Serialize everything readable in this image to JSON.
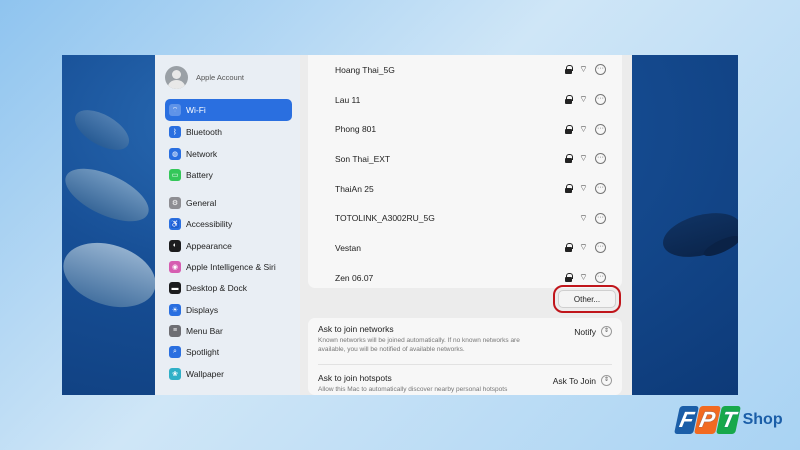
{
  "sidebar": {
    "account_label": "Apple Account",
    "items": [
      {
        "label": "Wi-Fi",
        "icon": "wifi-icon",
        "color": "#2a6fe0",
        "active": true
      },
      {
        "label": "Bluetooth",
        "icon": "bluetooth-icon",
        "color": "#2a6fe0"
      },
      {
        "label": "Network",
        "icon": "network-globe-icon",
        "color": "#2a6fe0"
      },
      {
        "label": "Battery",
        "icon": "battery-icon",
        "color": "#34c759"
      },
      {
        "label": "General",
        "icon": "gear-icon",
        "color": "#8e8e93"
      },
      {
        "label": "Accessibility",
        "icon": "accessibility-icon",
        "color": "#2a6fe0"
      },
      {
        "label": "Appearance",
        "icon": "appearance-icon",
        "color": "#1c1c1e"
      },
      {
        "label": "Apple Intelligence & Siri",
        "icon": "siri-icon",
        "color": "#d65db1"
      },
      {
        "label": "Desktop & Dock",
        "icon": "dock-icon",
        "color": "#1c1c1e"
      },
      {
        "label": "Displays",
        "icon": "display-icon",
        "color": "#2a6fe0"
      },
      {
        "label": "Menu Bar",
        "icon": "menu-bar-icon",
        "color": "#6e6e73"
      },
      {
        "label": "Spotlight",
        "icon": "spotlight-search-icon",
        "color": "#2a6fe0"
      },
      {
        "label": "Wallpaper",
        "icon": "wallpaper-icon",
        "color": "#30b0c7"
      }
    ]
  },
  "networks": [
    {
      "name": "Hoang Thai_5G",
      "locked": true
    },
    {
      "name": "Lau 11",
      "locked": true
    },
    {
      "name": "Phong 801",
      "locked": true
    },
    {
      "name": "Son Thai_EXT",
      "locked": true
    },
    {
      "name": "ThaiAn 25",
      "locked": true
    },
    {
      "name": "TOTOLINK_A3002RU_5G",
      "locked": false
    },
    {
      "name": "Vestan",
      "locked": true
    },
    {
      "name": "Zen 06.07",
      "locked": true
    }
  ],
  "other_button": "Other...",
  "settings": {
    "ask_networks": {
      "title": "Ask to join networks",
      "desc": "Known networks will be joined automatically. If no known networks are available, you will be notified of available networks.",
      "value": "Notify"
    },
    "ask_hotspots": {
      "title": "Ask to join hotspots",
      "desc": "Allow this Mac to automatically discover nearby personal hotspots when no Wi-Fi network is available.",
      "value": "Ask To Join"
    }
  },
  "brand": {
    "f": "F",
    "p": "P",
    "t": "T",
    "shop": "Shop",
    "colors": {
      "f": "#1b5ea8",
      "p": "#f26a21",
      "t": "#17a84b"
    }
  }
}
